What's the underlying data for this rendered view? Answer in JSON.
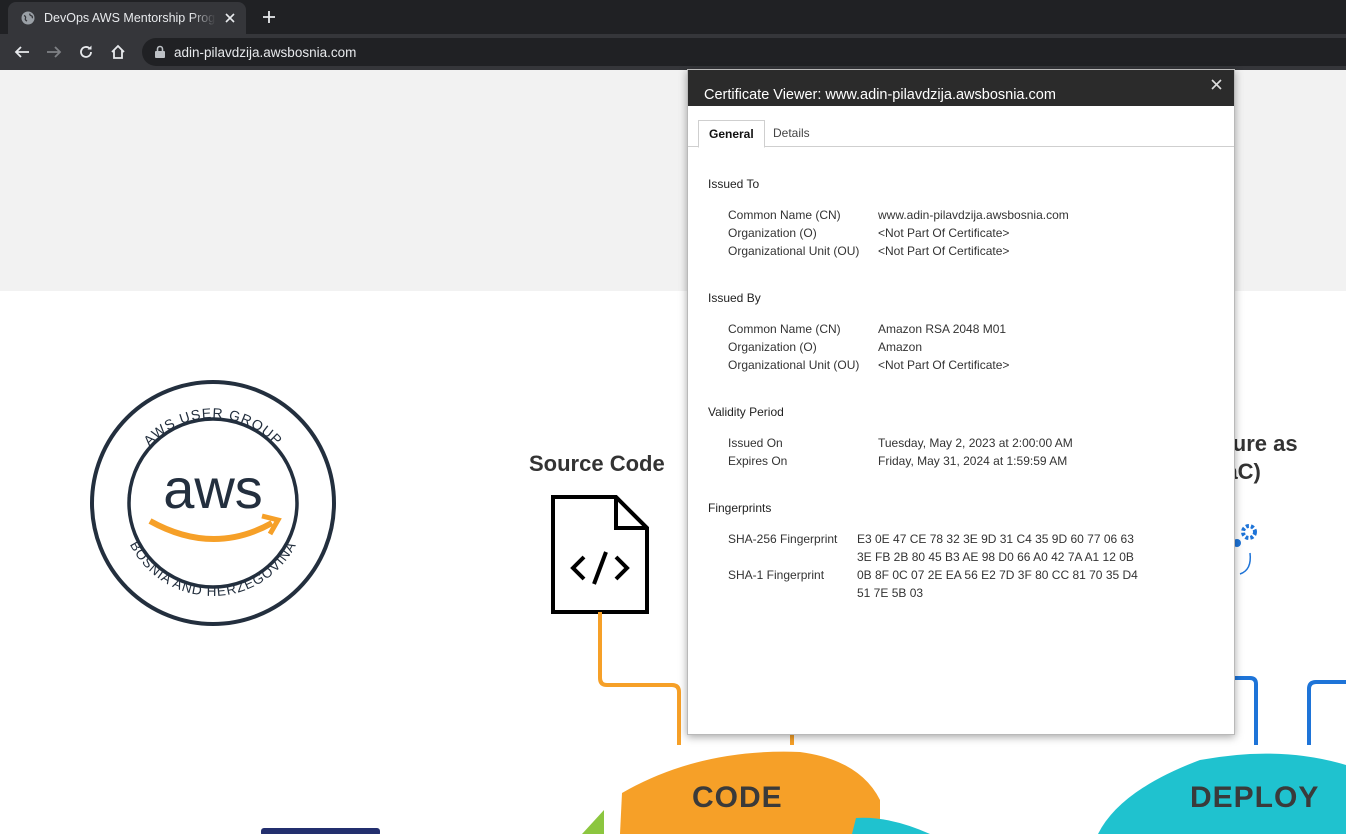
{
  "browser": {
    "tab_title": "DevOps AWS Mentorship Program",
    "url": "adin-pilavdzija.awsbosnia.com",
    "icons": [
      "globe-icon",
      "close-icon",
      "plus-icon",
      "back-arrow-icon",
      "forward-arrow-icon",
      "reload-icon",
      "home-icon",
      "lock-icon"
    ]
  },
  "page": {
    "logo_top_text": "AWS USER GROUP",
    "logo_center_text": "aws",
    "logo_bottom_text": "BOSNIA AND HERZEGOVINA",
    "source_code_title": "Source Code",
    "iac_title_line1": "uture as",
    "iac_title_line2": "(IaC)",
    "code_label": "CODE",
    "deploy_label": "DEPLOY",
    "colors": {
      "orange": "#f6a028",
      "teal": "#1fc2cf",
      "blue": "#1e74d8",
      "green": "#8cc63f",
      "navy": "#232f3e"
    }
  },
  "cert_viewer": {
    "title": "Certificate Viewer: www.adin-pilavdzija.awsbosnia.com",
    "tabs": [
      {
        "label": "General",
        "active": true
      },
      {
        "label": "Details",
        "active": false
      }
    ],
    "issued_to": {
      "heading": "Issued To",
      "rows": [
        {
          "label": "Common Name (CN)",
          "value": "www.adin-pilavdzija.awsbosnia.com"
        },
        {
          "label": "Organization (O)",
          "value": "<Not Part Of Certificate>"
        },
        {
          "label": "Organizational Unit (OU)",
          "value": "<Not Part Of Certificate>"
        }
      ]
    },
    "issued_by": {
      "heading": "Issued By",
      "rows": [
        {
          "label": "Common Name (CN)",
          "value": "Amazon RSA 2048 M01"
        },
        {
          "label": "Organization (O)",
          "value": "Amazon"
        },
        {
          "label": "Organizational Unit (OU)",
          "value": "<Not Part Of Certificate>"
        }
      ]
    },
    "validity": {
      "heading": "Validity Period",
      "rows": [
        {
          "label": "Issued On",
          "value": "Tuesday, May 2, 2023 at 2:00:00 AM"
        },
        {
          "label": "Expires On",
          "value": "Friday, May 31, 2024 at 1:59:59 AM"
        }
      ]
    },
    "fingerprints": {
      "heading": "Fingerprints",
      "sha256_label": "SHA-256 Fingerprint",
      "sha256_line1": "E3 0E 47 CE 78 32 3E 9D 31 C4 35 9D 60 77 06 63",
      "sha256_line2": "3E FB 2B 80 45 B3 AE 98 D0 66 A0 42 7A A1 12 0B",
      "sha1_label": "SHA-1 Fingerprint",
      "sha1_line1": "0B 8F 0C 07 2E EA 56 E2 7D 3F 80 CC 81 70 35 D4",
      "sha1_line2": "51 7E 5B 03"
    }
  }
}
